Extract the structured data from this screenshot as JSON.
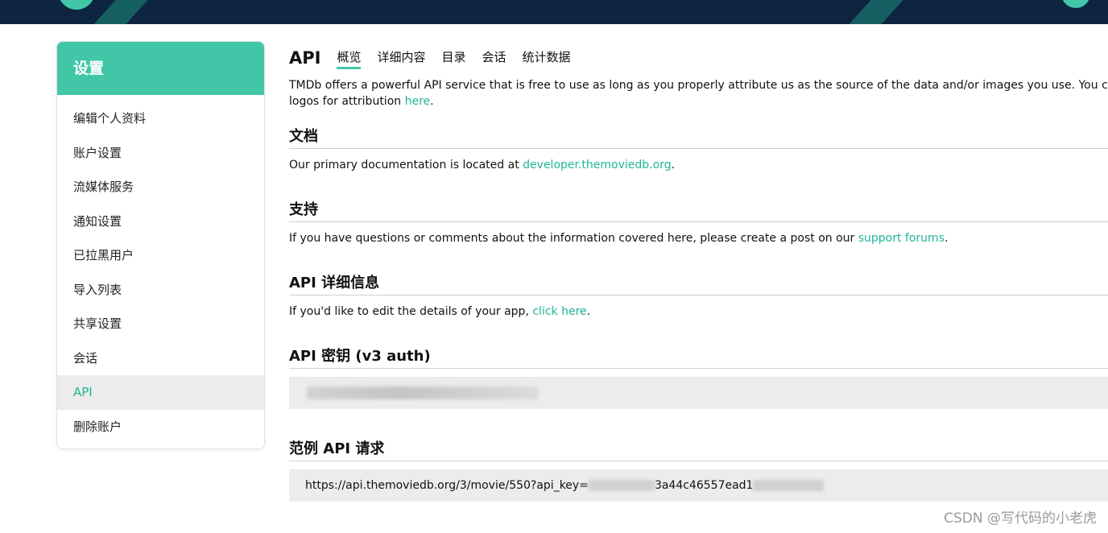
{
  "sidebar": {
    "title": "设置",
    "items": [
      {
        "label": "编辑个人资料"
      },
      {
        "label": "账户设置"
      },
      {
        "label": "流媒体服务"
      },
      {
        "label": "通知设置"
      },
      {
        "label": "已拉黑用户"
      },
      {
        "label": "导入列表"
      },
      {
        "label": "共享设置"
      },
      {
        "label": "会话"
      },
      {
        "label": "API",
        "active": true
      },
      {
        "label": "删除账户"
      }
    ]
  },
  "header": {
    "title": "API",
    "tabs": [
      "概览",
      "详细内容",
      "目录",
      "会话",
      "统计数据"
    ],
    "active_tab": "概览"
  },
  "intro": {
    "line1": "TMDb offers a powerful API service that is free to use as long as you properly attribute us as the source of the data and/or images you use. You can find th",
    "line2_prefix": "logos for attribution ",
    "line2_link": "here",
    "line2_suffix": "."
  },
  "docs": {
    "heading": "文档",
    "text": "Our primary documentation is located at ",
    "link": "developer.themoviedb.org",
    "suffix": "."
  },
  "support": {
    "heading": "支持",
    "text": "If you have questions or comments about the information covered here, please create a post on our ",
    "link": "support forums",
    "suffix": "."
  },
  "details": {
    "heading": "API 详细信息",
    "text": "If you'd like to edit the details of your app, ",
    "link": "click here",
    "suffix": "."
  },
  "apikey": {
    "heading": "API 密钥 (v3 auth)"
  },
  "example": {
    "heading": "范例 API 请求",
    "url_prefix": "https://api.themoviedb.org/3/movie/550?api_key=",
    "url_visible_part": "3a44c46557ead1"
  },
  "watermark": "CSDN @写代码的小老虎",
  "colors": {
    "accent": "#41c7a8",
    "link": "#1fb59a",
    "topbar": "#0d2541"
  }
}
